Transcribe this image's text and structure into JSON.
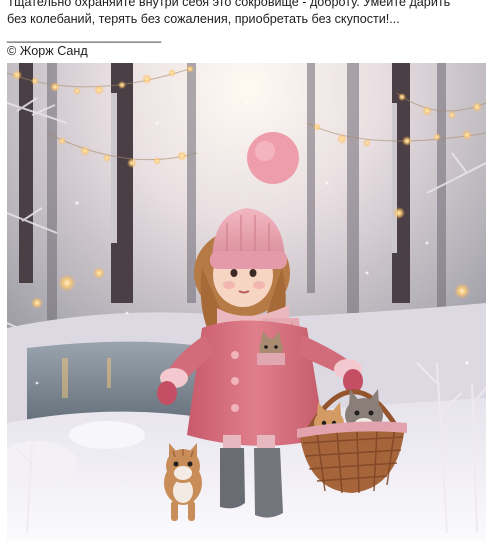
{
  "post": {
    "quote_lines": [
      "Тщательно охраняйте внутри себя это сокровище - доброту. Умейте дарить",
      "без колебаний, терять без сожаления, приобретать без скупости!...",
      "______________________"
    ],
    "attribution": "© Жорж Санд"
  },
  "photo": {
    "scene": "girl-in-pink-coat-with-kittens-in-winter-forest",
    "colors": {
      "coat": "#d9727f",
      "hat": "#e9a9b3",
      "scarf": "#eab8be",
      "snow": "#f4f1f5",
      "water": "#7d8b96",
      "lights": "#ffcf7a",
      "basket": "#a5643a"
    }
  }
}
